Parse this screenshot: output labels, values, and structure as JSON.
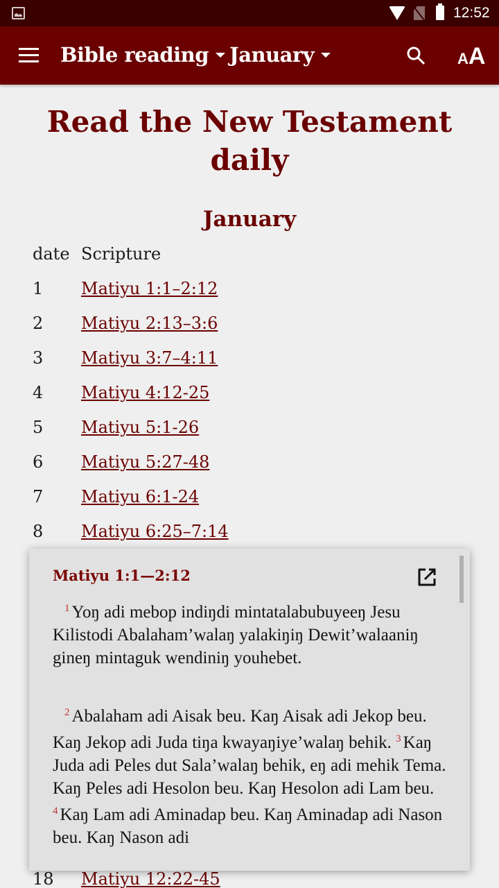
{
  "status_bar": {
    "notification_icon": "image-icon",
    "wifi_icon": "wifi-icon",
    "sim_icon": "no-sim-icon",
    "battery_icon": "battery-icon",
    "time": "12:52"
  },
  "app_bar": {
    "menu_icon": "menu-icon",
    "book_dropdown": "Bible reading",
    "month_dropdown": "January",
    "search_icon": "search-icon",
    "text_size_icon": "text-size-icon",
    "text_size_small": "A",
    "text_size_big": "A"
  },
  "page": {
    "title": "Read the New Testament daily",
    "month_heading": "January",
    "columns": {
      "date": "date",
      "scripture": "Scripture"
    },
    "readings": [
      {
        "date": "1",
        "ref": "Matiyu 1:1–2:12"
      },
      {
        "date": "2",
        "ref": "Matiyu 2:13–3:6"
      },
      {
        "date": "3",
        "ref": "Matiyu 3:7–4:11"
      },
      {
        "date": "4",
        "ref": "Matiyu 4:12-25"
      },
      {
        "date": "5",
        "ref": "Matiyu 5:1-26"
      },
      {
        "date": "6",
        "ref": "Matiyu 5:27-48"
      },
      {
        "date": "7",
        "ref": "Matiyu 6:1-24"
      },
      {
        "date": "8",
        "ref": "Matiyu 6:25–7:14"
      },
      {
        "date": "18",
        "ref": "Matiyu 12:22-45"
      }
    ]
  },
  "popup": {
    "reference": "Matiyu 1:1—2:12",
    "open_icon": "open-in-new-icon",
    "verses": [
      {
        "num": "1",
        "text": "Yoŋ adi mebop indiŋdi mintatalabubuyeeŋ Jesu Kilistodi Abalaham’walaŋ yalakiŋiŋ Dewit’walaaniŋ gineŋ mintaguk wendiniŋ youhebet."
      },
      {
        "num": "2",
        "text": "Abalaham adi Aisak beu. Kaŋ Aisak adi Jekop beu. Kaŋ Jekop adi Juda tiŋa kwayaŋiye’walaŋ behik. "
      },
      {
        "num": "3",
        "text": "Kaŋ Juda adi Peles dut Sala’walaŋ behik, eŋ adi mehik Tema. Kaŋ Peles adi Hesolon beu. Kaŋ Hesolon adi Lam beu. "
      },
      {
        "num": "4",
        "text": "Kaŋ Lam adi Aminadap beu. Kaŋ Aminadap adi Nason beu. Kaŋ Nason adi"
      }
    ]
  }
}
